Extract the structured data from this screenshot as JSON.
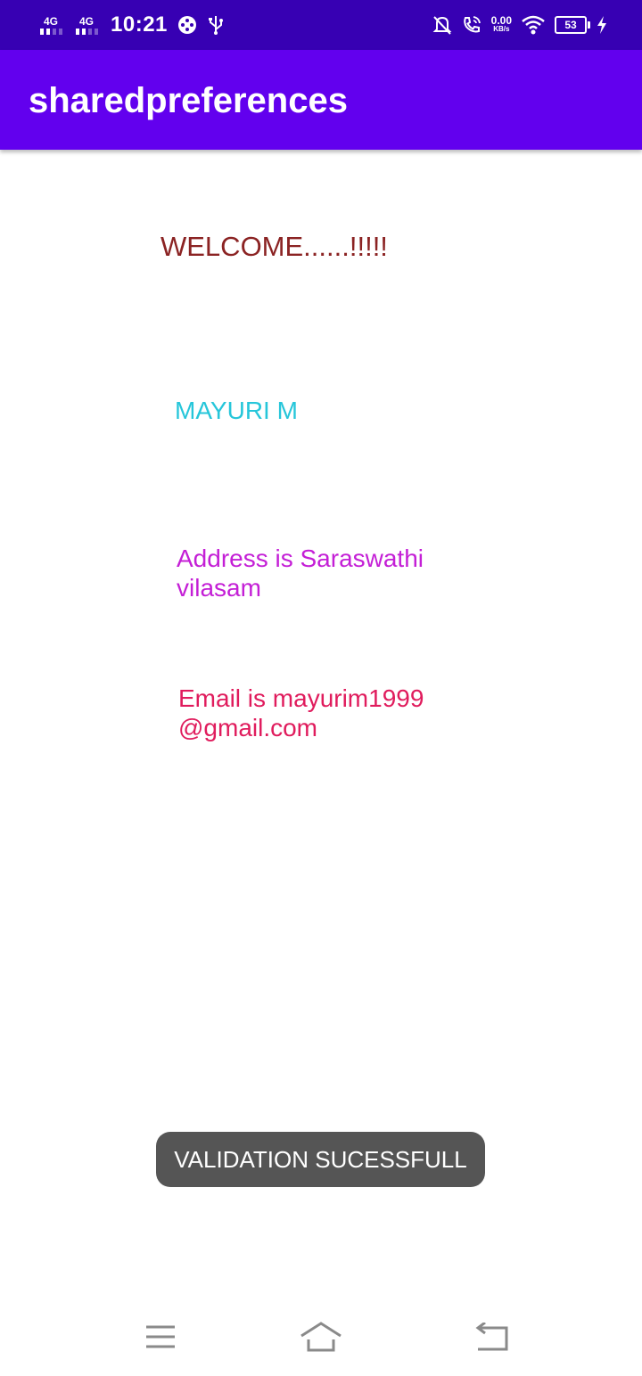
{
  "status_bar": {
    "network1": "4G",
    "network2": "4G",
    "time": "10:21",
    "speed_value": "0.00",
    "speed_unit": "KB/s",
    "battery_level": "53",
    "icons": [
      "signal-icon",
      "gamepad-icon",
      "usb-icon",
      "mute-icon",
      "call-icon",
      "wifi-icon",
      "battery-icon",
      "charging-icon"
    ]
  },
  "app_bar": {
    "title": "sharedpreferences"
  },
  "content": {
    "welcome": "WELCOME......!!!!!",
    "name": "MAYURI M",
    "address": "Address is Saraswathi vilasam",
    "email": "Email is mayurim1999@gmail.com"
  },
  "toast": {
    "message": "VALIDATION SUCESSFULL"
  },
  "nav_bar": {
    "icons": [
      "menu-icon",
      "home-icon",
      "back-icon"
    ]
  },
  "colors": {
    "status_bar": "#3700b3",
    "app_bar": "#6200ee",
    "welcome": "#8b2323",
    "name": "#26c6da",
    "address": "#c41fd6",
    "email": "#e01c5d",
    "toast_bg": "#555555"
  }
}
